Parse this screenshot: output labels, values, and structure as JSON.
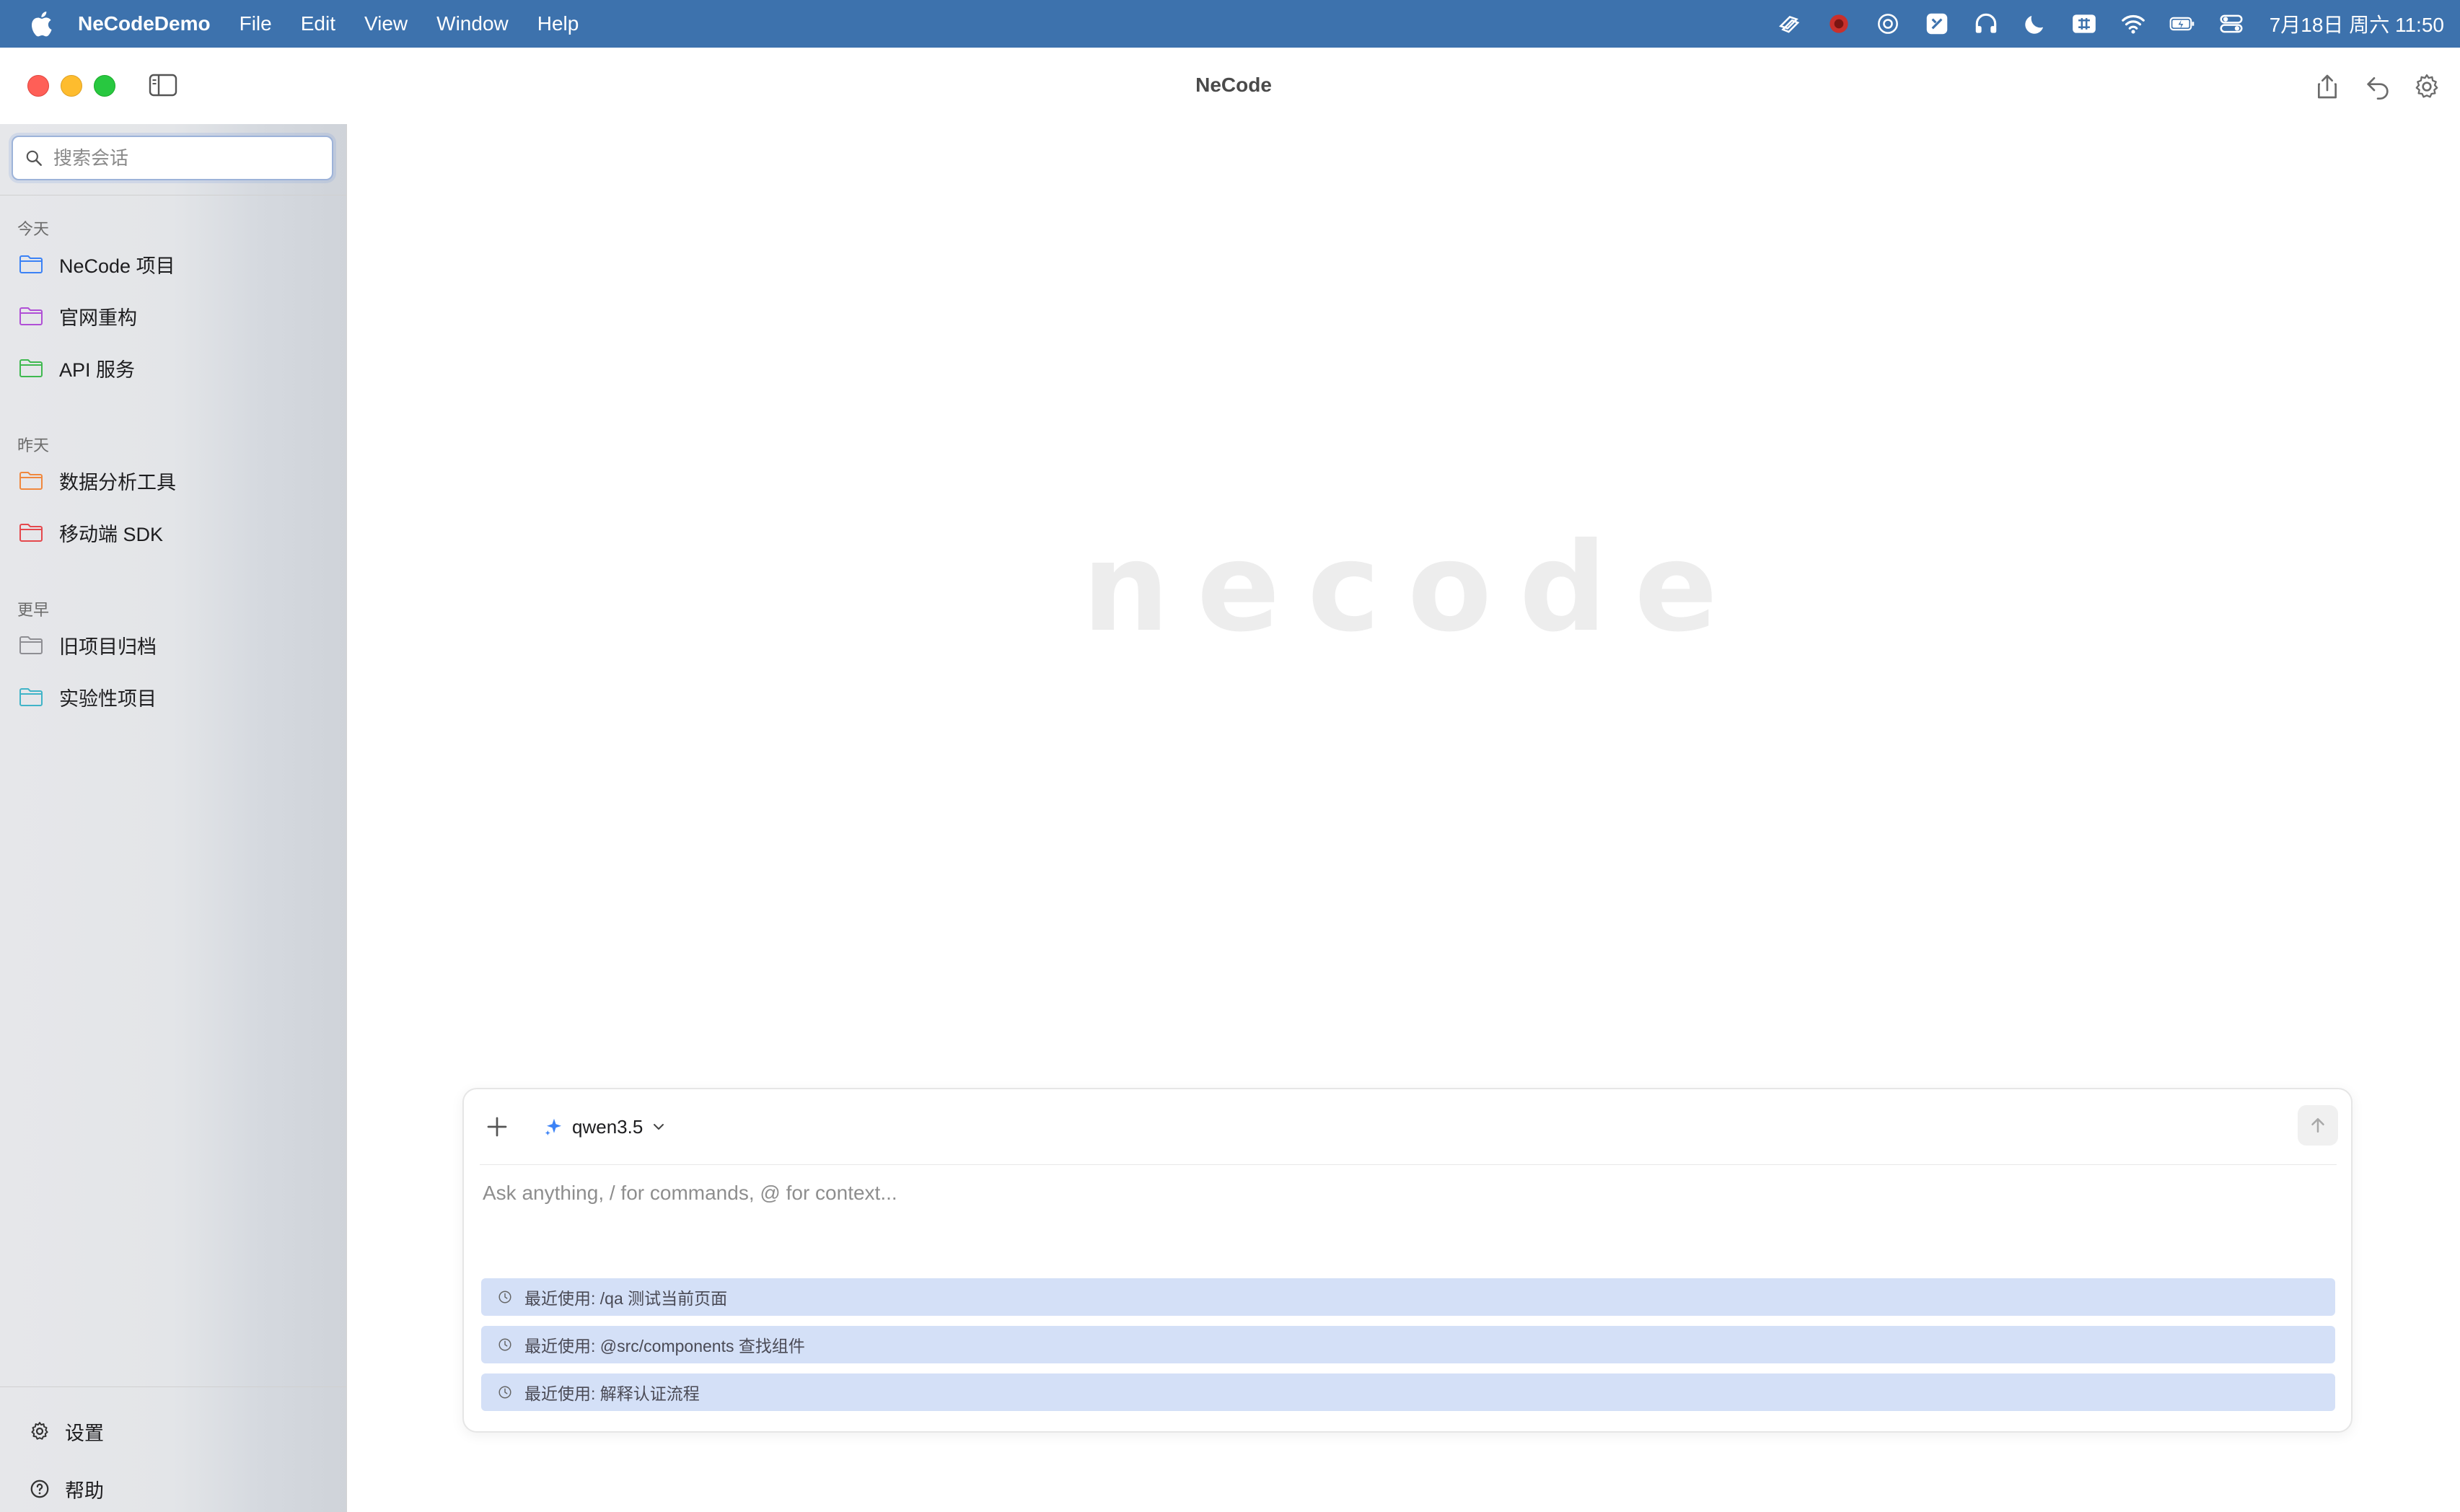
{
  "menubar": {
    "app_name": "NeCodeDemo",
    "items": [
      "File",
      "Edit",
      "View",
      "Window",
      "Help"
    ],
    "clock": "7月18日 周六 11:50"
  },
  "window": {
    "title": "NeCode"
  },
  "sidebar": {
    "search_placeholder": "搜索会话",
    "groups": [
      {
        "label": "今天",
        "items": [
          {
            "label": "NeCode 项目",
            "color": "#3b82f6"
          },
          {
            "label": "官网重构",
            "color": "#b04fd6"
          },
          {
            "label": "API 服务",
            "color": "#3fb950"
          }
        ]
      },
      {
        "label": "昨天",
        "items": [
          {
            "label": "数据分析工具",
            "color": "#f0883e"
          },
          {
            "label": "移动端 SDK",
            "color": "#e5484d"
          }
        ]
      },
      {
        "label": "更早",
        "items": [
          {
            "label": "旧项目归档",
            "color": "#8e8e93"
          },
          {
            "label": "实验性项目",
            "color": "#40b4c8"
          }
        ]
      }
    ],
    "footer": {
      "settings": "设置",
      "help": "帮助"
    }
  },
  "main": {
    "watermark": "necode",
    "composer": {
      "model": "qwen3.5",
      "placeholder": "Ask anything, / for commands, @ for context...",
      "recent": [
        "最近使用: /qa 测试当前页面",
        "最近使用: @src/components 查找组件",
        "最近使用: 解释认证流程"
      ]
    }
  }
}
